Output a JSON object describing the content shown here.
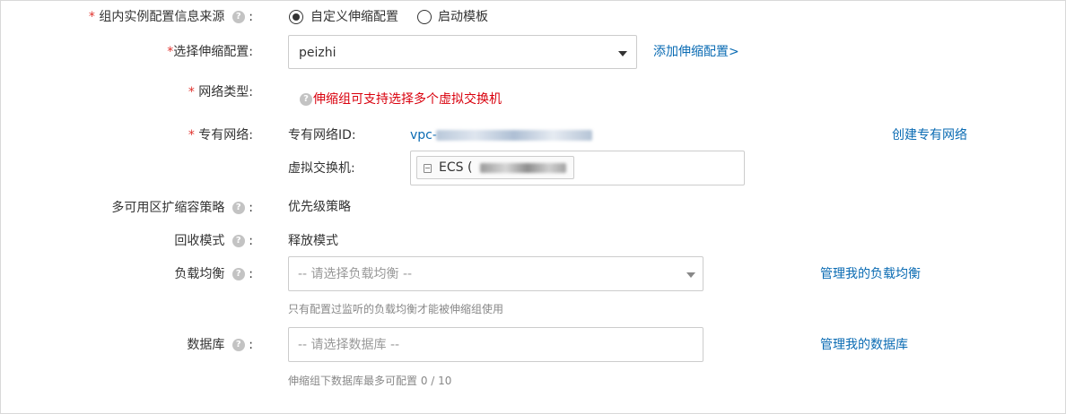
{
  "form": {
    "required_mark": "*",
    "source": {
      "label": "组内实例配置信息来源",
      "suffix": ":",
      "options": [
        {
          "label": "自定义伸缩配置",
          "selected": true
        },
        {
          "label": "启动模板",
          "selected": false
        }
      ]
    },
    "scaling_config": {
      "label": "选择伸缩配置",
      "suffix": ":",
      "value": "peizhi",
      "add_link": "添加伸缩配置>"
    },
    "network_type": {
      "label": "网络类型",
      "suffix": ":",
      "warning": "伸缩组可支持选择多个虚拟交换机"
    },
    "vpc": {
      "label": "专有网络",
      "suffix": ":",
      "vpc_id_label": "专有网络ID:",
      "vpc_id_prefix": "vpc-",
      "create_link": "创建专有网络",
      "vswitch_label": "虚拟交换机:",
      "vswitch_tag_prefix": "ECS ("
    },
    "multi_zone": {
      "label": "多可用区扩缩容策略",
      "suffix": ":",
      "value": "优先级策略"
    },
    "recycle": {
      "label": "回收模式",
      "suffix": ":",
      "value": "释放模式"
    },
    "load_balancer": {
      "label": "负载均衡",
      "suffix": ":",
      "placeholder": "-- 请选择负载均衡 --",
      "manage_link": "管理我的负载均衡",
      "hint": "只有配置过监听的负载均衡才能被伸缩组使用"
    },
    "database": {
      "label": "数据库",
      "suffix": ":",
      "placeholder": "-- 请选择数据库 --",
      "manage_link": "管理我的数据库",
      "hint_text": "伸缩组下数据库最多可配置",
      "hint_count": "0 / 10"
    }
  },
  "colors": {
    "link": "#0a6bb3",
    "required": "#e0322d",
    "warning": "#d9000d"
  }
}
